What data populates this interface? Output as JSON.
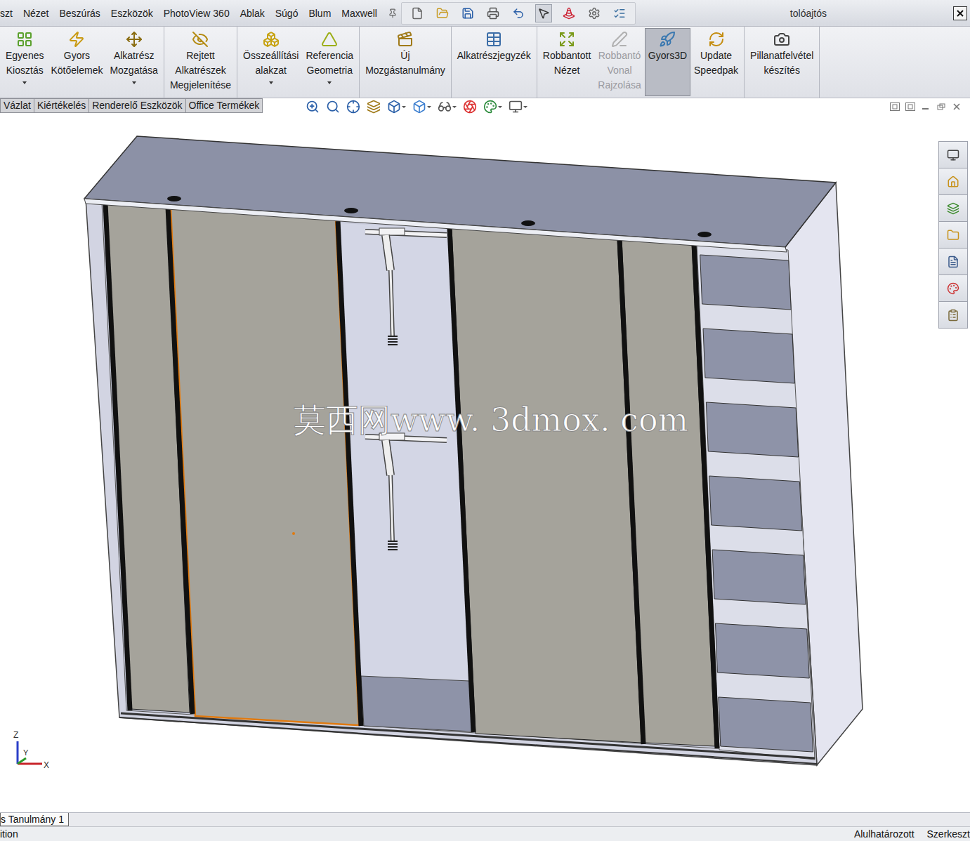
{
  "window": {
    "title": "tolóajtós"
  },
  "menu": [
    "szt",
    "Nézet",
    "Beszúrás",
    "Eszközök",
    "PhotoView 360",
    "Ablak",
    "Súgó",
    "Blum",
    "Maxwell"
  ],
  "ribbon": [
    {
      "buttons": [
        {
          "lines": [
            "Egyenes",
            "Kiosztás"
          ],
          "dropdown": true,
          "disabled": false,
          "selected": false
        },
        {
          "lines": [
            "Gyors",
            "Kötőelemek"
          ],
          "dropdown": false,
          "disabled": false,
          "selected": false
        },
        {
          "lines": [
            "Alkatrész",
            "Mozgatása"
          ],
          "dropdown": true,
          "disabled": false,
          "selected": false
        }
      ]
    },
    {
      "buttons": [
        {
          "lines": [
            "Rejtett",
            "Alkatrészek",
            "Megjelenítése"
          ],
          "dropdown": false,
          "disabled": false,
          "selected": false
        }
      ]
    },
    {
      "buttons": [
        {
          "lines": [
            "Összeállítási",
            "alakzat"
          ],
          "dropdown": true,
          "disabled": false,
          "selected": false
        },
        {
          "lines": [
            "Referencia",
            "Geometria"
          ],
          "dropdown": true,
          "disabled": false,
          "selected": false
        }
      ]
    },
    {
      "buttons": [
        {
          "lines": [
            "Új",
            "Mozgástanulmány"
          ],
          "dropdown": false,
          "disabled": false,
          "selected": false
        }
      ]
    },
    {
      "buttons": [
        {
          "lines": [
            "Alkatrészjegyzék"
          ],
          "dropdown": false,
          "disabled": false,
          "selected": false
        }
      ]
    },
    {
      "buttons": [
        {
          "lines": [
            "Robbantott",
            "Nézet"
          ],
          "dropdown": false,
          "disabled": false,
          "selected": false
        },
        {
          "lines": [
            "Robbantó",
            "Vonal",
            "Rajzolása"
          ],
          "dropdown": false,
          "disabled": true,
          "selected": false
        },
        {
          "lines": [
            "Gyors3D"
          ],
          "dropdown": false,
          "disabled": false,
          "selected": true
        },
        {
          "lines": [
            "Update",
            "Speedpak"
          ],
          "dropdown": false,
          "disabled": false,
          "selected": false
        }
      ]
    },
    {
      "buttons": [
        {
          "lines": [
            "Pillanatfelvétel",
            "készítés"
          ],
          "dropdown": false,
          "disabled": false,
          "selected": false
        }
      ]
    }
  ],
  "tabs": [
    {
      "label": "Vázlat",
      "selected": false
    },
    {
      "label": "Kiértékelés",
      "selected": false
    },
    {
      "label": "Renderelő Eszközök",
      "selected": false
    },
    {
      "label": "Office Termékek",
      "selected": false
    }
  ],
  "model": {
    "doors": [
      {
        "selected": false
      },
      {
        "selected": true
      },
      {
        "selected": false
      },
      {
        "selected": false
      }
    ],
    "watermark": "莫西网www. 3dmox. com"
  },
  "triad": {
    "z": "Z",
    "y": "Y",
    "x": "X"
  },
  "bottom_tabs": [
    {
      "label": "s Tanulmány 1",
      "selected": true
    }
  ],
  "status_bar": {
    "left": "ition",
    "right": [
      "Alulhatározott",
      "Szerkeszt"
    ]
  }
}
